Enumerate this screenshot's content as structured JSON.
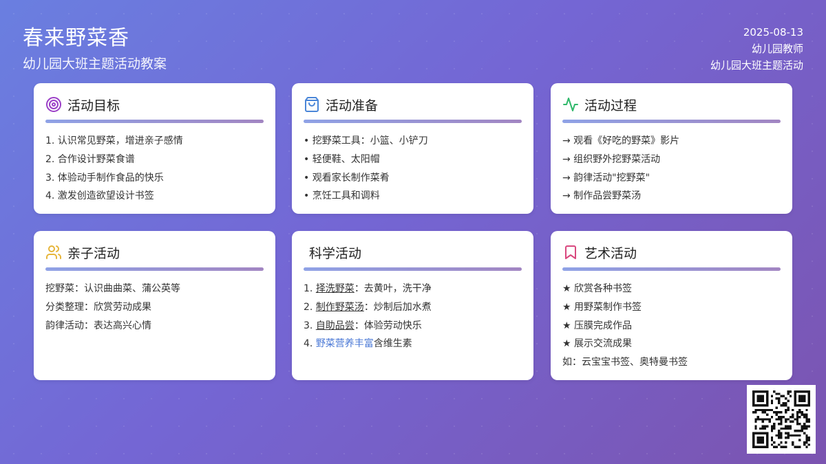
{
  "header": {
    "title": "春来野菜香",
    "subtitle": "幼儿园大班主题活动教案",
    "date": "2025-08-13",
    "author": "幼儿园教师",
    "category": "幼儿园大班主题活动"
  },
  "cards": {
    "goals": {
      "title": "活动目标",
      "icon": "target-icon",
      "items": [
        "1. 认识常见野菜，增进亲子感情",
        "2. 合作设计野菜食谱",
        "3. 体验动手制作食品的快乐",
        "4. 激发创造欲望设计书签"
      ]
    },
    "prep": {
      "title": "活动准备",
      "icon": "shopping-bag-icon",
      "items": [
        "• 挖野菜工具：小篮、小铲刀",
        "• 轻便鞋、太阳帽",
        "• 观看家长制作菜肴",
        "• 烹饪工具和调料"
      ]
    },
    "process": {
      "title": "活动过程",
      "icon": "activity-pulse-icon",
      "items": [
        "→ 观看《好吃的野菜》影片",
        "→ 组织野外挖野菜活动",
        "→ 韵律活动\"挖野菜\"",
        "→ 制作品尝野菜汤"
      ]
    },
    "family": {
      "title": "亲子活动",
      "icon": "users-icon",
      "items": [
        "挖野菜：认识曲曲菜、蒲公英等",
        "分类整理：欣赏劳动成果",
        "韵律活动：表达高兴心情"
      ]
    },
    "science": {
      "title": "科学活动",
      "items": [
        {
          "num": "1. ",
          "key": "择洗野菜",
          "rest": "：去黄叶，洗干净"
        },
        {
          "num": "2. ",
          "key": "制作野菜汤",
          "rest": "：炒制后加水煮"
        },
        {
          "num": "3. ",
          "key": "自助品尝",
          "rest": "：体验劳动快乐"
        },
        {
          "num": "4. ",
          "key": "野菜营养丰富",
          "rest": "含维生素"
        }
      ]
    },
    "art": {
      "title": "艺术活动",
      "icon": "bookmark-icon",
      "items": [
        "★ 欣赏各种书签",
        "★ 用野菜制作书签",
        "★ 压膜完成作品",
        "★ 展示交流成果",
        "如：云宝宝书签、奥特曼书签"
      ]
    }
  },
  "colors": {
    "target": "#9b3fc7",
    "bag": "#4a86d8",
    "pulse": "#2fb86a",
    "users": "#e6b53a",
    "bookmark": "#d9487e",
    "link": "#4a78d6"
  }
}
